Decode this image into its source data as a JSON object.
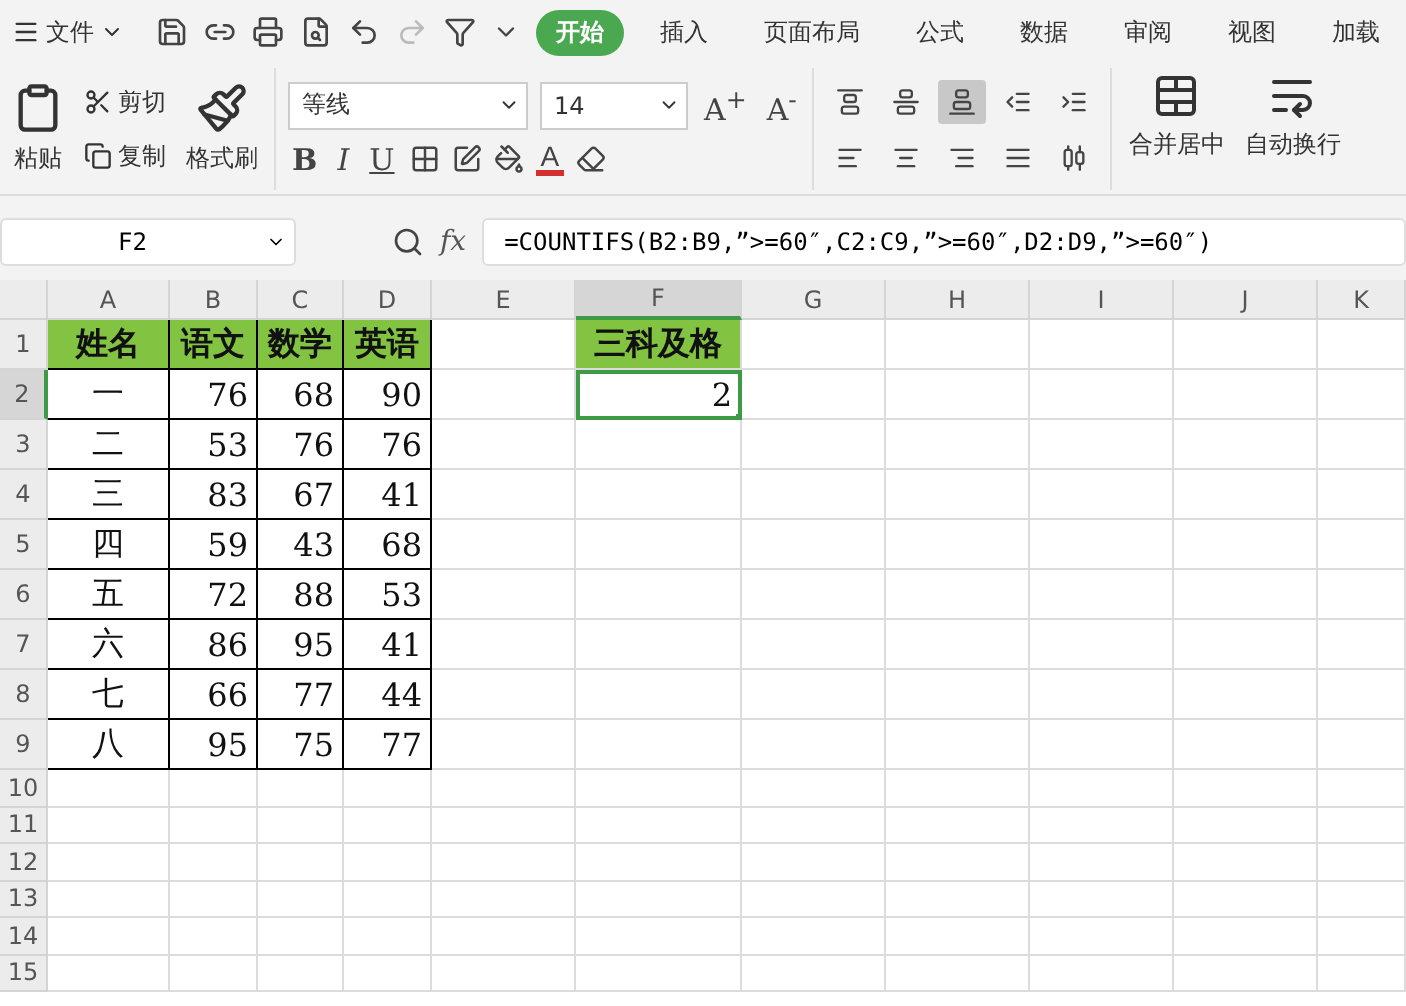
{
  "menu": {
    "label": "文件"
  },
  "tabs": [
    {
      "label": "开始",
      "selected": true
    },
    {
      "label": "插入",
      "selected": false
    },
    {
      "label": "页面布局",
      "selected": false
    },
    {
      "label": "公式",
      "selected": false
    },
    {
      "label": "数据",
      "selected": false
    },
    {
      "label": "审阅",
      "selected": false
    },
    {
      "label": "视图",
      "selected": false
    },
    {
      "label": "加载",
      "selected": false
    }
  ],
  "clipboard": {
    "paste": "粘贴",
    "cut": "剪切",
    "copy": "复制",
    "format_painter": "格式刷"
  },
  "font": {
    "name": "等线",
    "size": "14",
    "grow": "A$^{+}$",
    "shrink": "A$^{-}$",
    "bold": "B",
    "italic": "I",
    "underline": "U",
    "font_color_letter": "A"
  },
  "alignment": [
    {
      "kind": "top",
      "selected": false
    },
    {
      "kind": "middle",
      "selected": false
    },
    {
      "kind": "bottom",
      "selected": true
    },
    {
      "kind": "outdent",
      "selected": false
    },
    {
      "kind": "indent",
      "selected": false
    },
    {
      "kind": "left",
      "selected": false
    },
    {
      "kind": "center",
      "selected": false
    },
    {
      "kind": "right",
      "selected": false
    },
    {
      "kind": "justify",
      "selected": false
    },
    {
      "kind": "distributed",
      "selected": false
    }
  ],
  "merge": {
    "label": "合并居中"
  },
  "wrap": {
    "label": "自动换行"
  },
  "name_box": {
    "value": "F2"
  },
  "formula_bar": {
    "fx": "fx",
    "value": "=COUNTIFS(B2:B9,”>=60″,C2:C9,”>=60″,D2:D9,”>=60″)"
  },
  "columns": [
    {
      "label": "A",
      "selected": false
    },
    {
      "label": "B",
      "selected": false
    },
    {
      "label": "C",
      "selected": false
    },
    {
      "label": "D",
      "selected": false
    },
    {
      "label": "E",
      "selected": false
    },
    {
      "label": "F",
      "selected": true
    },
    {
      "label": "G",
      "selected": false
    },
    {
      "label": "H",
      "selected": false
    },
    {
      "label": "I",
      "selected": false
    },
    {
      "label": "J",
      "selected": false
    },
    {
      "label": "K",
      "selected": false
    }
  ],
  "rows": [
    {
      "label": "1",
      "selected": false
    },
    {
      "label": "2",
      "selected": true
    },
    {
      "label": "3",
      "selected": false
    },
    {
      "label": "4",
      "selected": false
    },
    {
      "label": "5",
      "selected": false
    },
    {
      "label": "6",
      "selected": false
    },
    {
      "label": "7",
      "selected": false
    },
    {
      "label": "8",
      "selected": false
    },
    {
      "label": "9",
      "selected": false
    },
    {
      "label": "10",
      "selected": false
    },
    {
      "label": "11",
      "selected": false
    },
    {
      "label": "12",
      "selected": false
    },
    {
      "label": "13",
      "selected": false
    },
    {
      "label": "14",
      "selected": false
    },
    {
      "label": "15",
      "selected": false
    }
  ],
  "score_table": {
    "header": [
      "姓名",
      "语文",
      "数学",
      "英语"
    ],
    "rows": [
      [
        "一",
        "76",
        "68",
        "90"
      ],
      [
        "二",
        "53",
        "76",
        "76"
      ],
      [
        "三",
        "83",
        "67",
        "41"
      ],
      [
        "四",
        "59",
        "43",
        "68"
      ],
      [
        "五",
        "72",
        "88",
        "53"
      ],
      [
        "六",
        "86",
        "95",
        "41"
      ],
      [
        "七",
        "66",
        "77",
        "44"
      ],
      [
        "八",
        "95",
        "75",
        "77"
      ]
    ]
  },
  "result": {
    "header": "三科及格",
    "value": "2",
    "selected": true
  }
}
